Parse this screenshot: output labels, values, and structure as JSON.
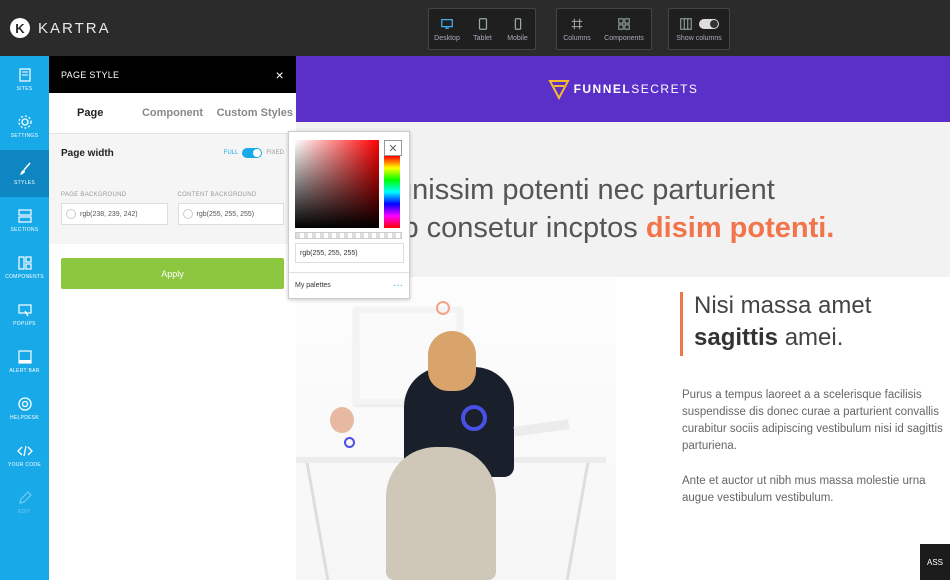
{
  "app": {
    "logo_letter": "K",
    "logo_text": "KARTRA"
  },
  "toolbar": {
    "devices": [
      {
        "label": "Desktop",
        "icon": "desktop-icon"
      },
      {
        "label": "Tablet",
        "icon": "tablet-icon"
      },
      {
        "label": "Mobile",
        "icon": "mobile-icon"
      }
    ],
    "tools": [
      {
        "label": "Columns",
        "icon": "columns-icon"
      },
      {
        "label": "Components",
        "icon": "components-icon"
      }
    ],
    "show_columns": "Show columns"
  },
  "sidebar": {
    "items": [
      {
        "label": "SITES"
      },
      {
        "label": "SETTINGS"
      },
      {
        "label": "STYLES"
      },
      {
        "label": "SECTIONS"
      },
      {
        "label": "COMPONENTS"
      },
      {
        "label": "POPUPS"
      },
      {
        "label": "ALERT BAR"
      },
      {
        "label": "HELPDESK"
      },
      {
        "label": "YOUR CODE"
      },
      {
        "label": "EDIT"
      }
    ]
  },
  "panel": {
    "title": "PAGE STYLE",
    "close": "×",
    "tabs": [
      "Page",
      "Component",
      "Custom Styles"
    ],
    "page_width_label": "Page width",
    "toggle_full": "FULL",
    "toggle_fixed": "FIXED",
    "page_background_label": "PAGE BACKGROUND",
    "page_background_value": "rgb(238, 239, 242)",
    "content_background_label": "CONTENT BACKGROUND",
    "content_background_value": "rgb(255, 255, 255)",
    "apply_label": "Apply"
  },
  "picker": {
    "value": "rgb(255, 255, 255)",
    "palettes_label": "My palettes",
    "more": "···"
  },
  "site": {
    "brand_bold": "FUNNEL",
    "brand_rest": " SECRETS",
    "hero_line1": "gnissim potenti nec parturient",
    "hero_line2_a": "ip consetur incptos ",
    "hero_line2_b": "disim potenti.",
    "quote_line1": "Nisi massa amet",
    "quote_bold": "sagittis",
    "quote_rest": " amei.",
    "para1": "Purus a tempus laoreet a a scelerisque facilisis suspendisse dis donec curae a parturient convallis curabitur sociis adipiscing vestibulum nisi id sagittis parturiena.",
    "para2": "Ante et auctor ut nibh mus massa molestie urna augue vestibulum vestibulum.",
    "corner_label": "ASS"
  },
  "colors": {
    "sidebar": "#18a9e8",
    "accent_orange": "#f2744a",
    "header_purple": "#5b30c8",
    "apply_green": "#8dc63f"
  }
}
